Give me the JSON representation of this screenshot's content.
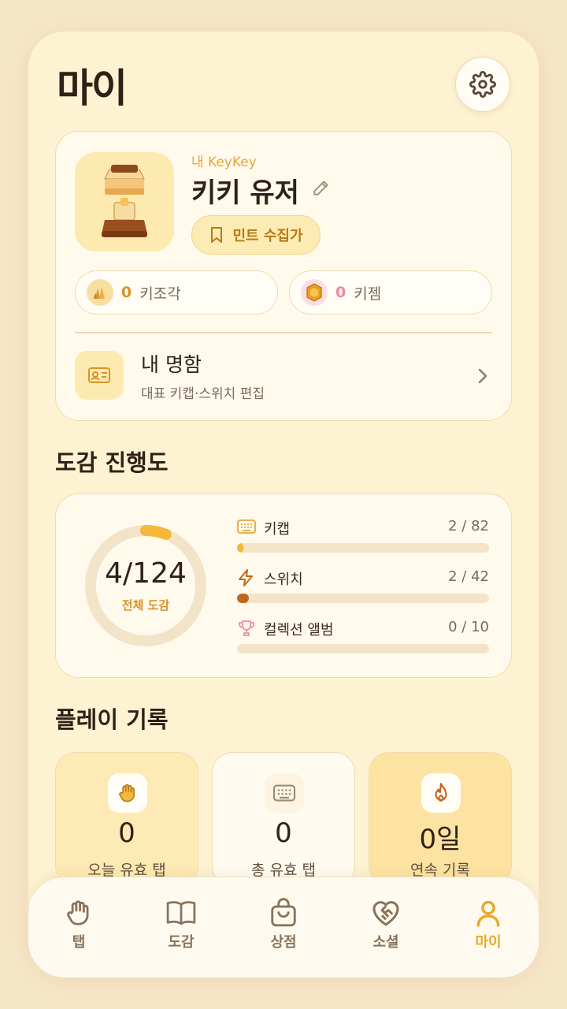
{
  "header": {
    "title": "마이"
  },
  "profile": {
    "mine_label": "내 KeyKey",
    "username": "키키 유저",
    "badge": "민트 수집가",
    "key_pieces": {
      "value": "0",
      "label": "키조각"
    },
    "key_gems": {
      "value": "0",
      "label": "키젬"
    },
    "namecard": {
      "title": "내 명함",
      "subtitle": "대표 키캡·스위치 편집"
    }
  },
  "progress": {
    "section_title": "도감 진행도",
    "total_count": "4/124",
    "total_label": "전체 도감",
    "total_fraction": 0.032,
    "rows": [
      {
        "label": "키캡",
        "count": "2 / 82",
        "fraction": 0.024,
        "color": "#f3b93a",
        "icon": "keyboard-icon"
      },
      {
        "label": "스위치",
        "count": "2 / 42",
        "fraction": 0.048,
        "color": "#c2661f",
        "icon": "lightning-icon"
      },
      {
        "label": "컬렉션 앨범",
        "count": "0 / 10",
        "fraction": 0.0,
        "color": "#f08fa3",
        "icon": "trophy-icon"
      }
    ]
  },
  "play": {
    "section_title": "플레이 기록",
    "stats": [
      {
        "value": "0",
        "label": "오늘 유효 탭",
        "icon": "hand-icon"
      },
      {
        "value": "0",
        "label": "총 유효 탭",
        "icon": "keyboard-icon"
      },
      {
        "value": "0일",
        "label": "연속 기록",
        "icon": "flame-icon"
      }
    ]
  },
  "nav": {
    "items": [
      {
        "label": "탭",
        "icon": "hand-icon"
      },
      {
        "label": "도감",
        "icon": "book-icon"
      },
      {
        "label": "상점",
        "icon": "bag-icon"
      },
      {
        "label": "소셜",
        "icon": "heart-handshake-icon"
      },
      {
        "label": "마이",
        "icon": "person-icon"
      }
    ],
    "active": "마이"
  },
  "colors": {
    "accent": "#e9a92b",
    "background": "#fdf2d2",
    "text": "#2f2116"
  }
}
